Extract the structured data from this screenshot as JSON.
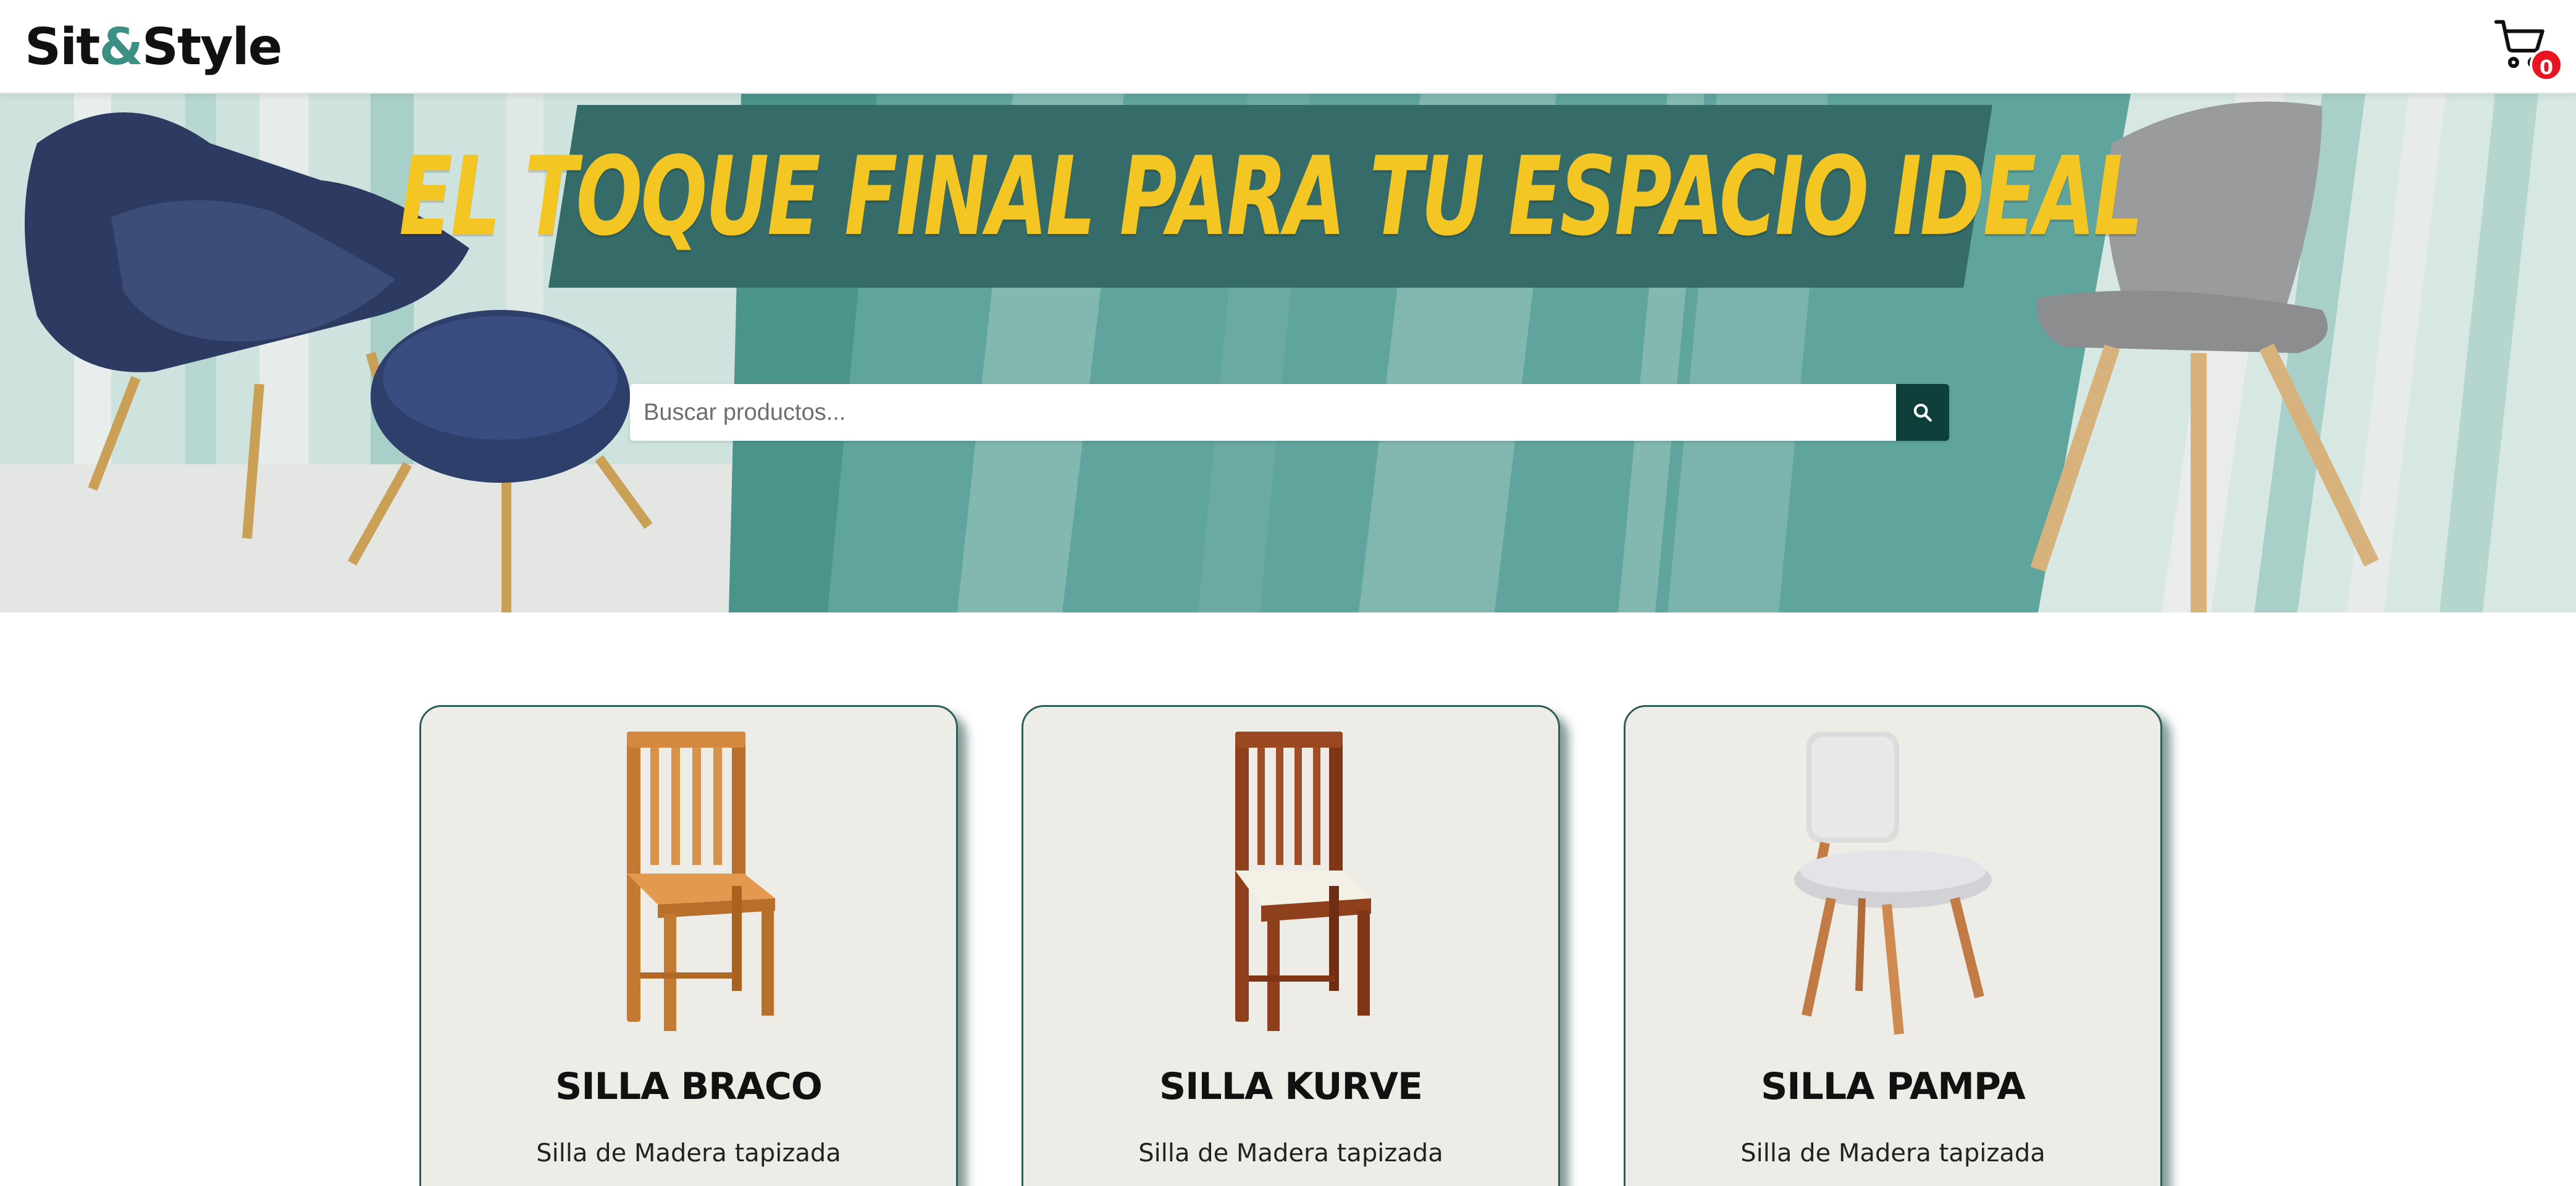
{
  "brand": {
    "name_part1": "Sit",
    "name_amp": "&",
    "name_part2": "Style"
  },
  "cart": {
    "icon": "shopping-cart-icon",
    "count": "0"
  },
  "hero": {
    "headline": "EL TOQUE FINAL PARA TU ESPACIO IDEAL",
    "search_placeholder": "Buscar productos...",
    "search_icon": "search-icon"
  },
  "products": [
    {
      "name": "SILLA BRACO",
      "description": "Silla de Madera tapizada"
    },
    {
      "name": "SILLA KURVE",
      "description": "Silla de Madera tapizada"
    },
    {
      "name": "SILLA PAMPA",
      "description": "Silla de Madera tapizada"
    }
  ],
  "colors": {
    "accent": "#3c8f85",
    "headline_text": "#f4c623",
    "headline_plate": "#356b68",
    "search_button": "#0f3f3a",
    "card_background": "#edece6",
    "card_border": "#2f5d58",
    "badge": "#e8141f"
  }
}
